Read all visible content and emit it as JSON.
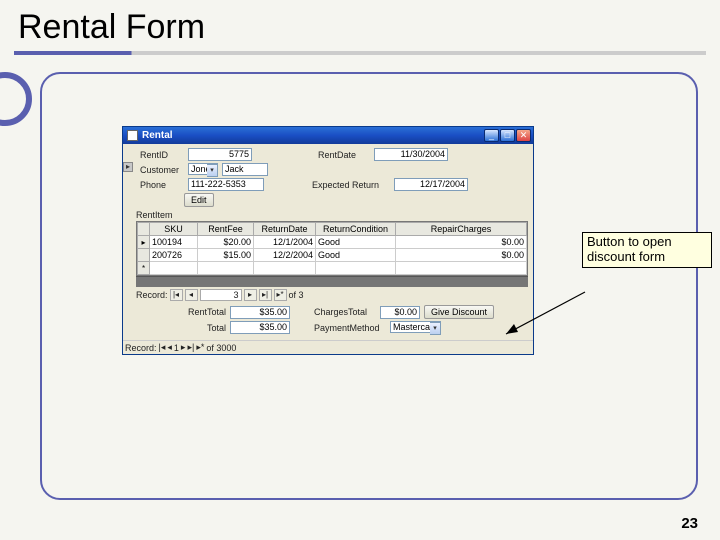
{
  "slide": {
    "title": "Rental Form",
    "page_number": "23"
  },
  "callout": {
    "text": "Button to open discount form"
  },
  "window": {
    "title": "Rental",
    "btn_min": "_",
    "btn_max": "□",
    "btn_close": "✕"
  },
  "form": {
    "rent_id_label": "RentID",
    "rent_id_value": "5775",
    "rent_date_label": "RentDate",
    "rent_date_value": "11/30/2004",
    "customer_label": "Customer",
    "customer_lastname": "Jones",
    "customer_firstname": "Jack",
    "phone_label": "Phone",
    "phone_value": "111-222-5353",
    "expected_return_label": "Expected Return",
    "expected_return_value": "12/17/2004",
    "edit_button": "Edit",
    "sub_label": "RentItem"
  },
  "grid": {
    "headers": [
      "SKU",
      "RentFee",
      "ReturnDate",
      "ReturnCondition",
      "RepairCharges"
    ],
    "rows": [
      {
        "sku": "100194",
        "fee": "$20.00",
        "ret": "12/1/2004",
        "cond": "Good",
        "rep": "$0.00"
      },
      {
        "sku": "200726",
        "fee": "$15.00",
        "ret": "12/2/2004",
        "cond": "Good",
        "rep": "$0.00"
      }
    ],
    "newrow_marker": "*"
  },
  "nav_inner": {
    "label": "Record:",
    "first": "|◂",
    "prev": "◂",
    "current": "3",
    "next": "▸",
    "last": "▸|",
    "new": "▸*",
    "of": "of  3"
  },
  "totals": {
    "rent_total_label": "RentTotal",
    "rent_total_value": "$35.00",
    "charges_total_label": "ChargesTotal",
    "charges_total_value": "$0.00",
    "give_discount_button": "Give Discount",
    "total_label": "Total",
    "total_value": "$35.00",
    "payment_method_label": "PaymentMethod",
    "payment_method_value": "Mastercard"
  },
  "nav_outer": {
    "label": "Record:",
    "first": "|◂",
    "prev": "◂",
    "current": "1",
    "next": "▸",
    "last": "▸|",
    "new": "▸*",
    "of": "of  3000"
  }
}
